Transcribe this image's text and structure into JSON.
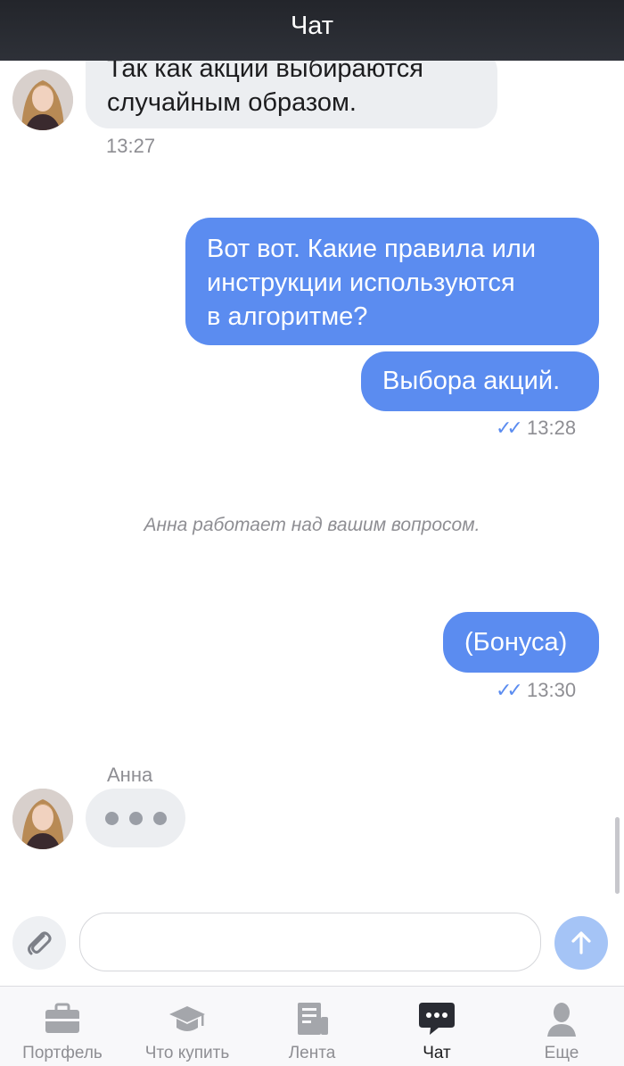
{
  "header": {
    "title": "Чат"
  },
  "messages": [
    {
      "direction": "in",
      "lines": [
        "Так как акции выбираются",
        "случайным образом."
      ],
      "time": "13:27"
    },
    {
      "direction": "out",
      "lines": [
        "Вот вот. Какие правила или",
        "инструкции используются",
        "в алгоритме?"
      ]
    },
    {
      "direction": "out",
      "lines": [
        "Выбора акций."
      ],
      "time": "13:28"
    },
    {
      "direction": "out",
      "lines": [
        "(Бонуса)"
      ],
      "time": "13:30"
    }
  ],
  "status_text": "Анна работает над вашим вопросом.",
  "typing": {
    "sender": "Анна"
  },
  "composer": {
    "placeholder": ""
  },
  "tabs": [
    {
      "label": "Портфель",
      "icon": "briefcase-icon",
      "active": false
    },
    {
      "label": "Что купить",
      "icon": "graduation-cap-icon",
      "active": false
    },
    {
      "label": "Лента",
      "icon": "newspaper-icon",
      "active": false
    },
    {
      "label": "Чат",
      "icon": "chat-bubble-icon",
      "active": true
    },
    {
      "label": "Еще",
      "icon": "person-icon",
      "active": false
    }
  ],
  "colors": {
    "header_bg": "#2b2d33",
    "bubble_out": "#5b8cf0",
    "bubble_in": "#eceef1",
    "send_button": "#a5c4f6",
    "read_ticks": "#5b8cf0"
  }
}
